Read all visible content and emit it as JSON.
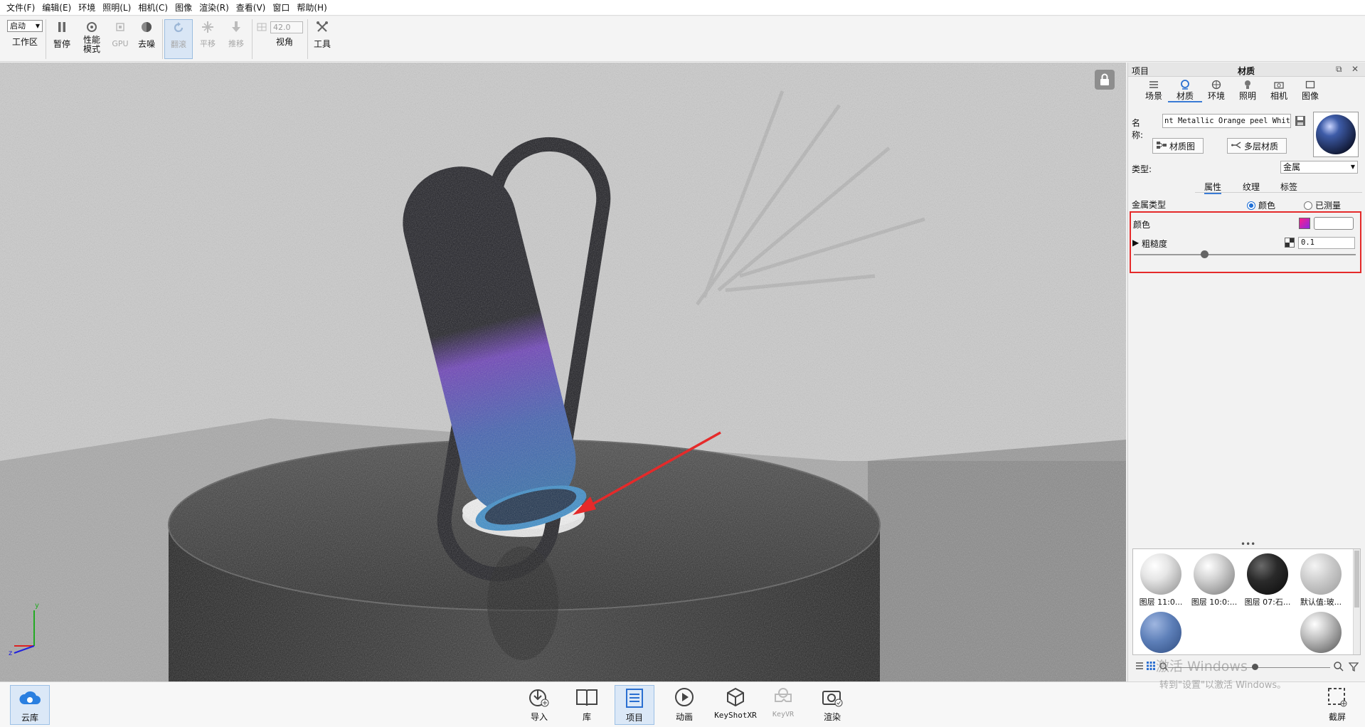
{
  "menu": [
    "文件(F)",
    "编辑(E)",
    "环境",
    "照明(L)",
    "相机(C)",
    "图像",
    "渲染(R)",
    "查看(V)",
    "窗口",
    "帮助(H)"
  ],
  "toolbar": {
    "start_select": "启动",
    "workspace": "工作区",
    "pause": "暂停",
    "perf_mode": "性能\n模式",
    "gpu": "GPU",
    "denoise": "去噪",
    "tumble": "翻滚",
    "pan": "平移",
    "dolly": "推移",
    "fov_value": "42.0",
    "view_angle": "视角",
    "tools": "工具"
  },
  "panel": {
    "title_left": "项目",
    "title_center": "材质",
    "tabs": [
      "场景",
      "材质",
      "环境",
      "照明",
      "相机",
      "图像"
    ],
    "active_tab": "材质",
    "name_label": "名称:",
    "name_value": "nt Metallic Orange peel White",
    "material_graph_btn": "材质图",
    "multi_layer_btn": "多层材质",
    "type_label": "类型:",
    "type_value": "金属",
    "subtabs": [
      "属性",
      "纹理",
      "标签"
    ],
    "metal_type_label": "金属类型",
    "radio_color": "颜色",
    "radio_measured": "已测量",
    "color_label": "颜色",
    "roughness_label": "粗糙度",
    "roughness_value": "0.1",
    "roughness_fraction": 0.32
  },
  "library": {
    "dots": "•••",
    "items": [
      {
        "caption": "图层 11:0...",
        "tone": "#e6e6e6"
      },
      {
        "caption": "图层 10:0:...",
        "tone": "#d4d4d4"
      },
      {
        "caption": "图层 07:石...",
        "tone": "#2a2a2a"
      },
      {
        "caption": "默认值:玻...",
        "tone": "#c9c9c9"
      },
      {
        "caption": "",
        "tone": "#5d7fb8"
      },
      {
        "caption": "",
        "tone": "#bdbdbd"
      }
    ]
  },
  "bottombar": {
    "cloud": "云库",
    "import": "导入",
    "library": "库",
    "project": "项目",
    "animation": "动画",
    "keyshotxr": "KeyShotXR",
    "keyvr": "KeyVR",
    "render": "渲染",
    "screenshot": "截屏"
  },
  "watermark": {
    "line1": "激活 Windows",
    "line2": "转到\"设置\"以激活 Windows。"
  },
  "colors": {
    "accent": "#3a7bd5",
    "highlight_box": "#e52a2a",
    "arrow": "#e52a2a",
    "swatch_start": "#ff1e8a",
    "swatch_end": "#8a2be2"
  }
}
